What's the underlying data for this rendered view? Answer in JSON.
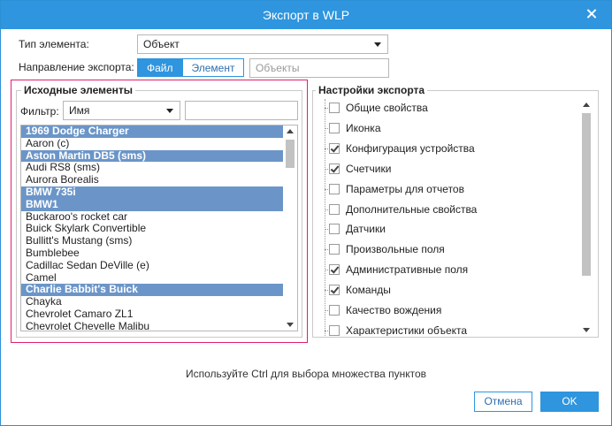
{
  "dialog": {
    "title": "Экспорт в WLP"
  },
  "form": {
    "type_label": "Тип элемента:",
    "type_value": "Объект",
    "direction_label": "Направление экспорта:",
    "direction_file": "Файл",
    "direction_element": "Элемент",
    "target_placeholder": "Объекты"
  },
  "source": {
    "title": "Исходные элементы",
    "filter_label": "Фильтр:",
    "filter_value": "Имя",
    "filter_text": "",
    "items": [
      {
        "label": "1969 Dodge Charger",
        "selected": true
      },
      {
        "label": "Aaron (c)",
        "selected": false
      },
      {
        "label": "Aston Martin DB5 (sms)",
        "selected": true
      },
      {
        "label": "Audi RS8 (sms)",
        "selected": false
      },
      {
        "label": "Aurora Borealis",
        "selected": false
      },
      {
        "label": "BMW 735i",
        "selected": true
      },
      {
        "label": "BMW1",
        "selected": true
      },
      {
        "label": "Buckaroo's rocket car",
        "selected": false
      },
      {
        "label": "Buick Skylark Convertible",
        "selected": false
      },
      {
        "label": "Bullitt's Mustang (sms)",
        "selected": false
      },
      {
        "label": "Bumblebee",
        "selected": false
      },
      {
        "label": "Cadillac Sedan DeVille (e)",
        "selected": false
      },
      {
        "label": "Camel",
        "selected": false
      },
      {
        "label": "Charlie Babbit's Buick",
        "selected": true
      },
      {
        "label": "Chayka",
        "selected": false
      },
      {
        "label": "Chevrolet Camaro ZL1",
        "selected": false
      },
      {
        "label": "Chevrolet Chevelle Malibu",
        "selected": false
      }
    ]
  },
  "settings": {
    "title": "Настройки экспорта",
    "options": [
      {
        "label": "Общие свойства",
        "checked": false
      },
      {
        "label": "Иконка",
        "checked": false
      },
      {
        "label": "Конфигурация устройства",
        "checked": true
      },
      {
        "label": "Счетчики",
        "checked": true
      },
      {
        "label": "Параметры для отчетов",
        "checked": false
      },
      {
        "label": "Дополнительные свойства",
        "checked": false
      },
      {
        "label": "Датчики",
        "checked": false
      },
      {
        "label": "Произвольные поля",
        "checked": false
      },
      {
        "label": "Административные поля",
        "checked": true
      },
      {
        "label": "Команды",
        "checked": true
      },
      {
        "label": "Качество вождения",
        "checked": false
      },
      {
        "label": "Характеристики объекта",
        "checked": false
      }
    ]
  },
  "footer": {
    "hint": "Используйте Ctrl для выбора множества пунктов",
    "cancel": "Отмена",
    "ok": "OK"
  },
  "colors": {
    "accent": "#2e95de",
    "selection": "#6b95c8",
    "highlight_border": "#e01f6e"
  }
}
